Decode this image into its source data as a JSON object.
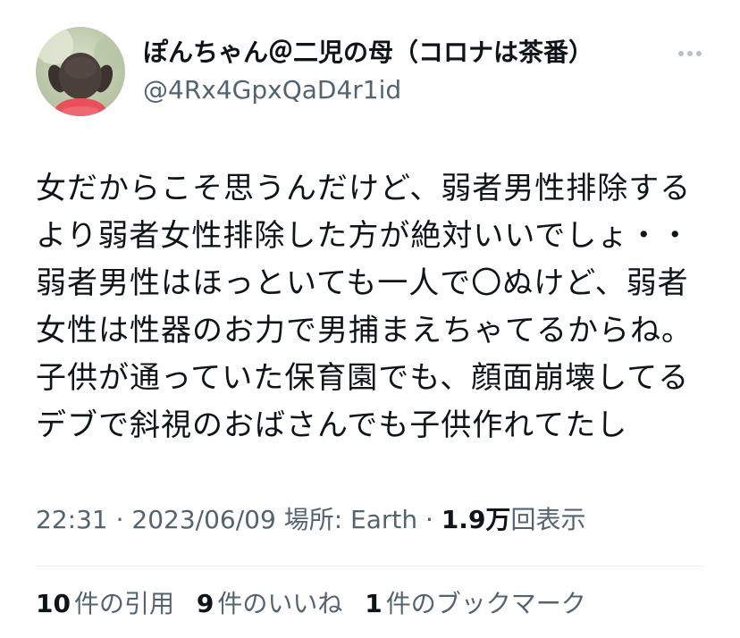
{
  "tweet": {
    "author": {
      "display_name": "ぽんちゃん＠二児の母（コロナは茶番）",
      "handle": "@4Rx4GpxQaD4r1id",
      "avatar_icon": "child-photo-avatar"
    },
    "more_icon": "more-dots-icon",
    "body_lines": [
      "女だからこそ思うんだけど、弱者男性排除する",
      "より弱者女性排除した方が絶対いいでしょ・・",
      "弱者男性はほっといても一人で〇ぬけど、弱者",
      "女性は性器のお力で男捕まえちゃてるからね。",
      "子供が通っていた保育園でも、顔面崩壊してる",
      "デブで斜視のおばさんでも子供作れてたし"
    ],
    "meta": {
      "time": "22:31",
      "sep1": " · ",
      "date": "2023/06/09",
      "location": " 場所: Earth",
      "sep2": " · ",
      "views_count": "1.9万",
      "views_label": "回表示"
    },
    "stats": {
      "quotes_count": "10",
      "quotes_label": "件の引用",
      "likes_count": "9",
      "likes_label": "件のいいね",
      "bookmarks_count": "1",
      "bookmarks_label": "件のブックマーク"
    }
  },
  "colors": {
    "primary_text": "#0f1419",
    "secondary_text": "#536471",
    "divider": "#eff3f4"
  }
}
